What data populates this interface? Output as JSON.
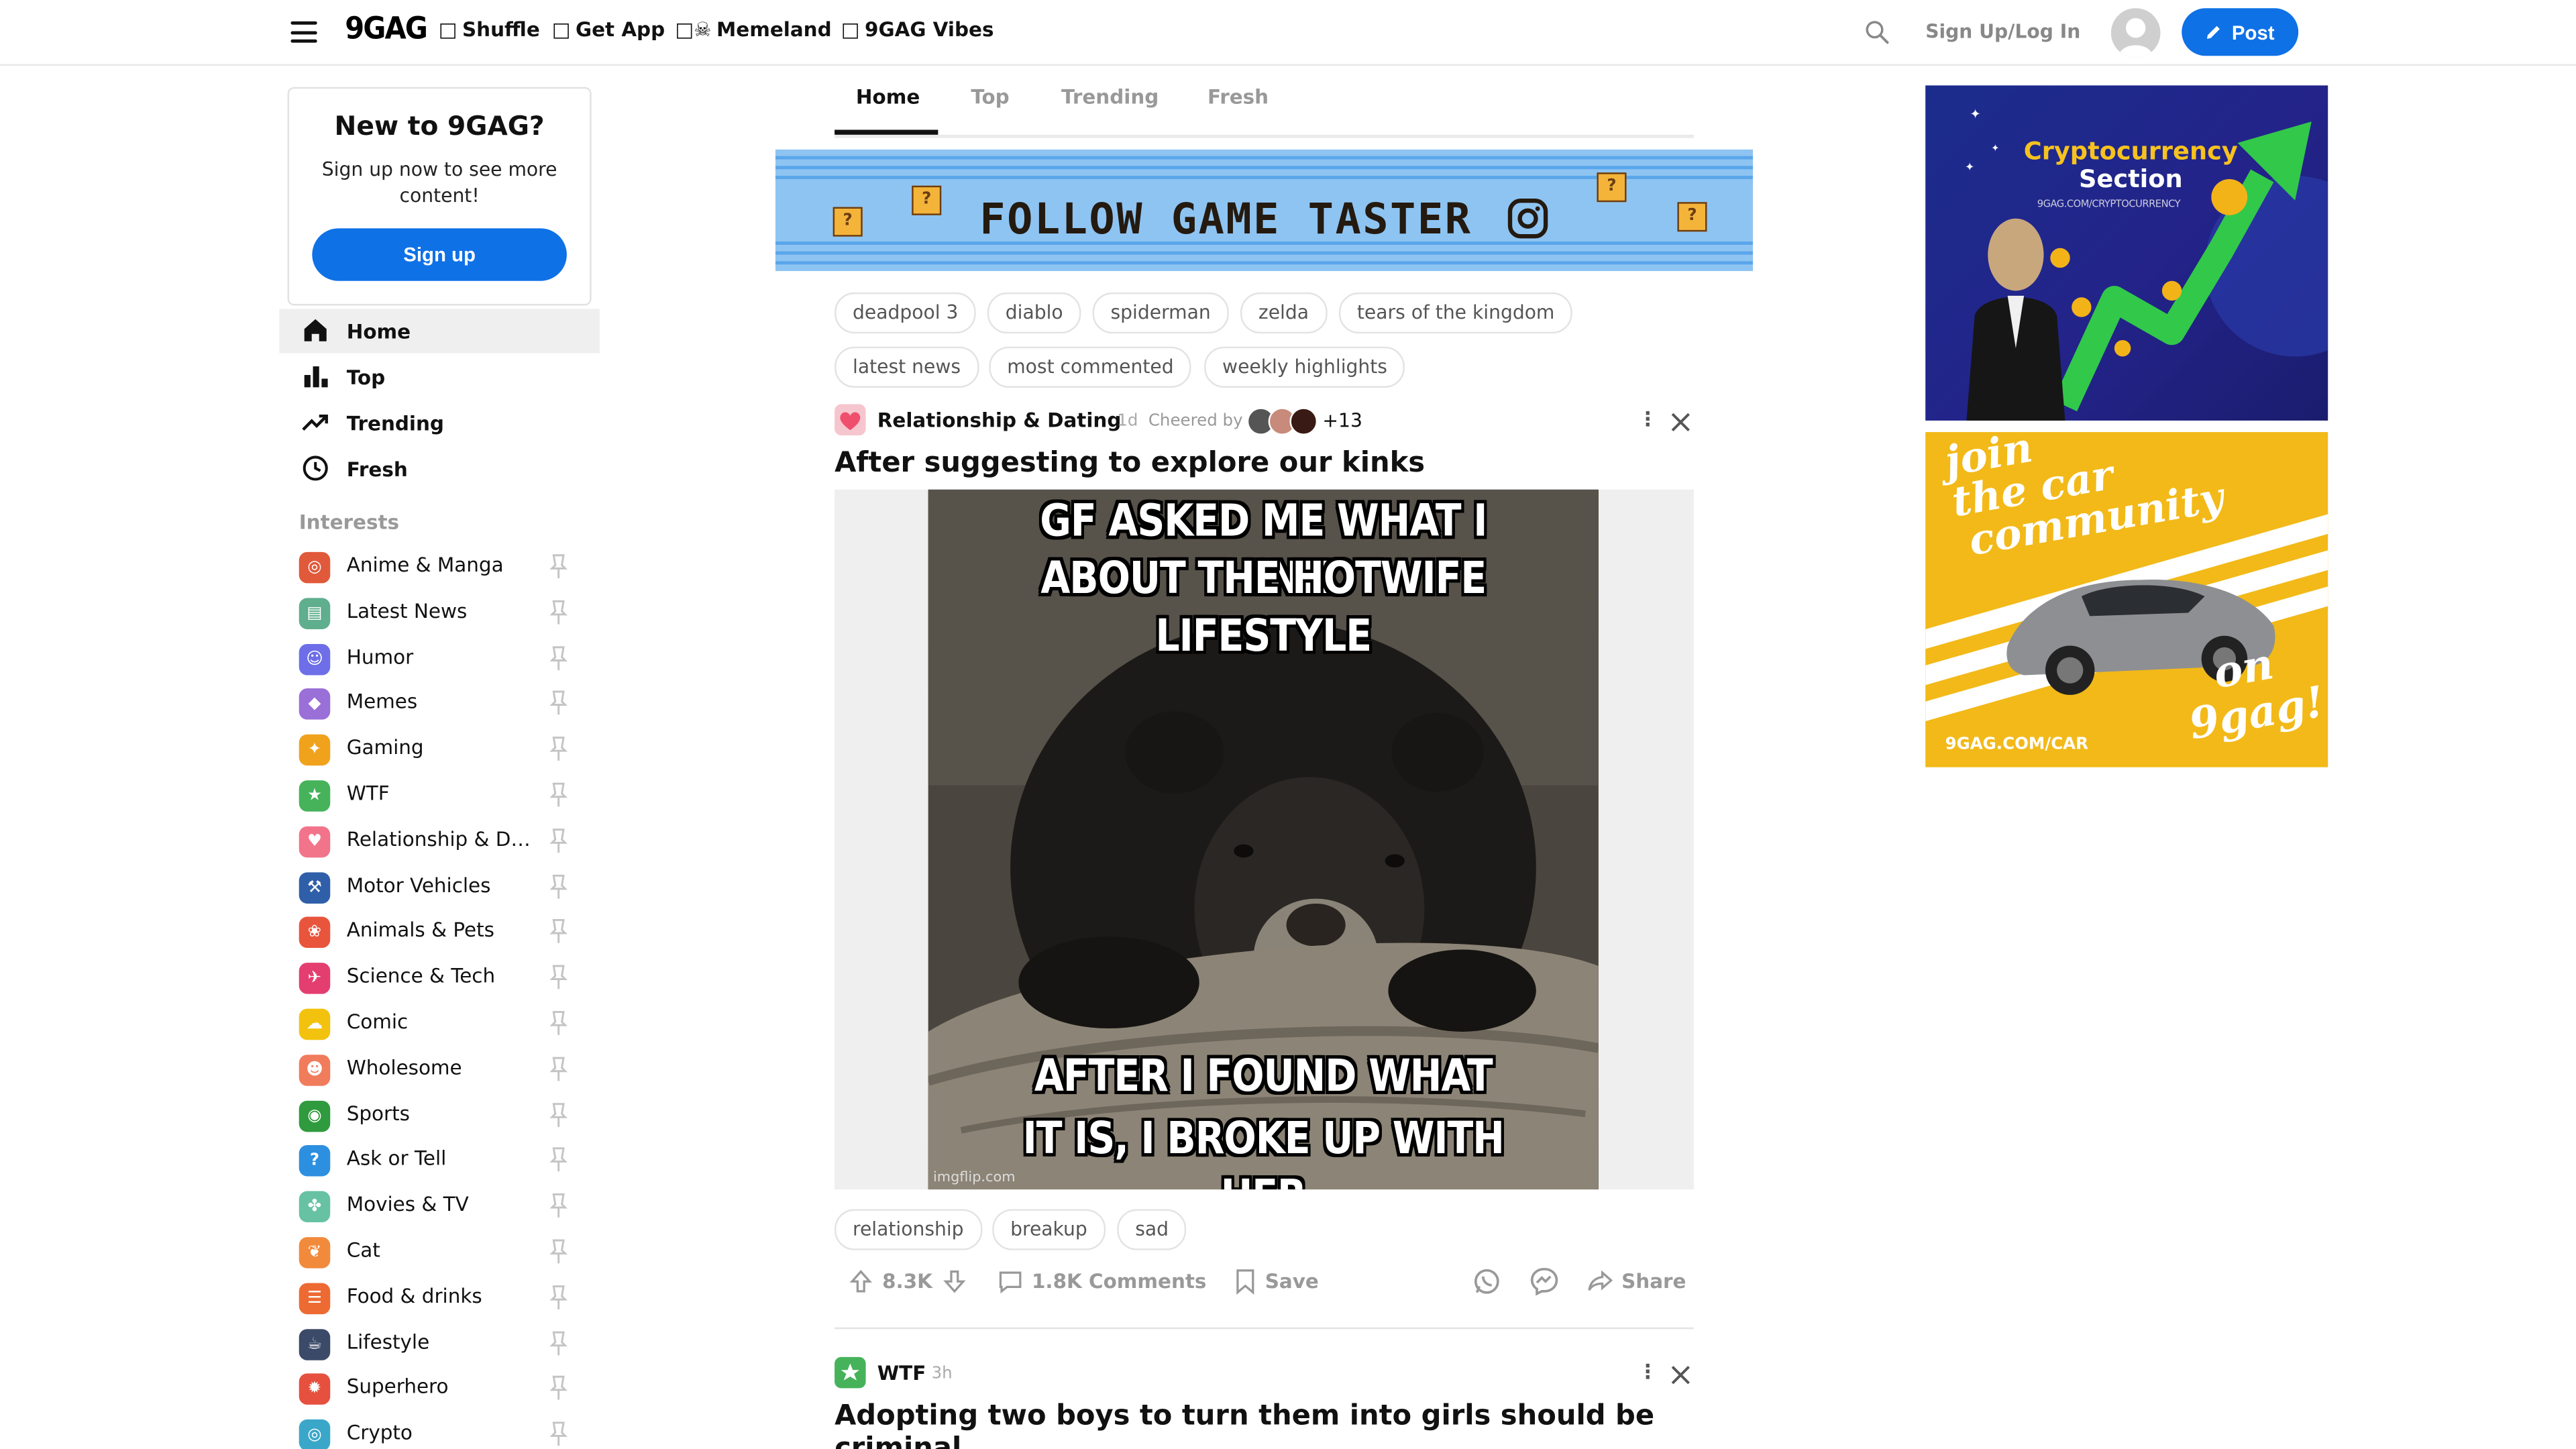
{
  "header": {
    "logo": "9GAG",
    "nav": [
      {
        "icon": "□",
        "label": "Shuffle"
      },
      {
        "icon": "□",
        "label": "Get App"
      },
      {
        "icon": "□☠︎",
        "label": "Memeland"
      },
      {
        "icon": "□",
        "label": "9GAG Vibes"
      }
    ],
    "login": "Sign Up/Log In",
    "post_label": "Post"
  },
  "signup_card": {
    "title": "New to 9GAG?",
    "subtitle": "Sign up now to see more content!",
    "button": "Sign up"
  },
  "sidebar": {
    "nav": [
      {
        "label": "Home",
        "icon": "home-icon",
        "active": true
      },
      {
        "label": "Top",
        "icon": "bar-chart-icon",
        "active": false
      },
      {
        "label": "Trending",
        "icon": "trending-icon",
        "active": false
      },
      {
        "label": "Fresh",
        "icon": "clock-icon",
        "active": false
      }
    ],
    "interests_heading": "Interests",
    "interests": [
      {
        "label": "Anime & Manga",
        "color": "#e0593a",
        "glyph": "◎"
      },
      {
        "label": "Latest News",
        "color": "#5fae8e",
        "glyph": "▤"
      },
      {
        "label": "Humor",
        "color": "#6d6ee8",
        "glyph": "☺"
      },
      {
        "label": "Memes",
        "color": "#9a6fd8",
        "glyph": "◆"
      },
      {
        "label": "Gaming",
        "color": "#f0a21c",
        "glyph": "✦"
      },
      {
        "label": "WTF",
        "color": "#46b35a",
        "glyph": "★"
      },
      {
        "label": "Relationship & Dating",
        "color": "#f2748b",
        "glyph": "♥"
      },
      {
        "label": "Motor Vehicles",
        "color": "#2f5fa8",
        "glyph": "⚒"
      },
      {
        "label": "Animals & Pets",
        "color": "#e9543d",
        "glyph": "❀"
      },
      {
        "label": "Science & Tech",
        "color": "#e43e70",
        "glyph": "✈"
      },
      {
        "label": "Comic",
        "color": "#f2c20f",
        "glyph": "☁"
      },
      {
        "label": "Wholesome",
        "color": "#f07c5c",
        "glyph": "☻"
      },
      {
        "label": "Sports",
        "color": "#2f9a3e",
        "glyph": "◉"
      },
      {
        "label": "Ask or Tell",
        "color": "#2d8fe0",
        "glyph": "?"
      },
      {
        "label": "Movies & TV",
        "color": "#67c2a3",
        "glyph": "✤"
      },
      {
        "label": "Cat",
        "color": "#f28a3c",
        "glyph": "❦"
      },
      {
        "label": "Food & drinks",
        "color": "#ee6a33",
        "glyph": "☰"
      },
      {
        "label": "Lifestyle",
        "color": "#3b4a68",
        "glyph": "☕"
      },
      {
        "label": "Superhero",
        "color": "#e6503e",
        "glyph": "✹"
      },
      {
        "label": "Crypto",
        "color": "#3aa7c9",
        "glyph": "◎"
      }
    ]
  },
  "main": {
    "tabs": [
      "Home",
      "Top",
      "Trending",
      "Fresh"
    ],
    "banner_text": "FOLLOW GAME TASTER",
    "chips_row1": [
      "deadpool 3",
      "diablo",
      "spiderman",
      "zelda",
      "tears of the kingdom"
    ],
    "chips_row2": [
      "latest news",
      "most commented",
      "weekly highlights"
    ],
    "post1": {
      "section": "Relationship & Dating",
      "time": "1d",
      "cheered_label": "Cheered by",
      "cheer_extra": "+13",
      "title": "After suggesting to explore our kinks",
      "meme_top": [
        "GF ASKED ME WHAT I THINK",
        "ABOUT THE HOTWIFE LIFESTYLE"
      ],
      "meme_bottom": [
        "AFTER I FOUND WHAT",
        "IT IS, I BROKE UP WITH HER"
      ],
      "watermark": "imgflip.com",
      "tags": [
        "relationship",
        "breakup",
        "sad"
      ],
      "upvotes": "8.3K",
      "comments": "1.8K Comments",
      "save": "Save",
      "share": "Share"
    },
    "post2": {
      "section": "WTF",
      "time": "3h",
      "title_line1": "Adopting two boys to turn them into girls should be",
      "title_line2": "criminal"
    }
  },
  "ads": {
    "crypto": {
      "title_line1": "Cryptocurrency",
      "title_line2": "Section",
      "url": "9GAG.COM/CRYPTOCURRENCY"
    },
    "car": {
      "line1": "join",
      "line2": "the car",
      "line3": "community",
      "line4": "on",
      "line5": "9gag!",
      "url": "9GAG.COM/CAR"
    }
  },
  "colors": {
    "accent": "#0f71e6",
    "banner_bg": "#8ec4f2",
    "ad_car_bg": "#f2b918",
    "ad_crypto_bg": "#1f2a8a"
  }
}
